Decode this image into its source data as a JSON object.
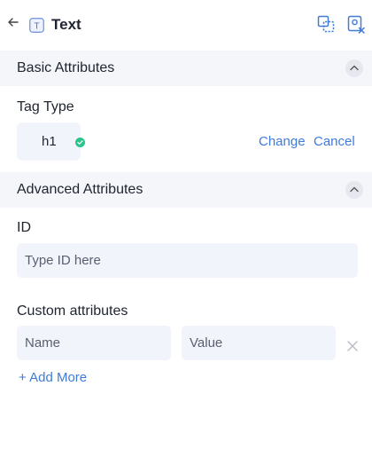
{
  "header": {
    "title": "Text",
    "badge_letter": "T",
    "icons": [
      "back-arrow-icon",
      "text-badge-icon",
      "copy-element-icon",
      "close-panel-icon"
    ]
  },
  "basic_attributes": {
    "title": "Basic Attributes",
    "tag_type_label": "Tag Type",
    "tag_value": "h1",
    "change_label": "Change",
    "cancel_label": "Cancel"
  },
  "advanced_attributes": {
    "title": "Advanced Attributes",
    "id_label": "ID",
    "id_value": "",
    "id_placeholder": "Type ID here",
    "custom_label": "Custom attributes",
    "name_placeholder": "Name",
    "value_placeholder": "Value",
    "add_more_label": "+ Add More"
  },
  "colors": {
    "accent": "#3f7bd8",
    "success": "#2bc48a",
    "field_bg": "#f2f4fb",
    "section_bg": "#f5f6fa"
  }
}
